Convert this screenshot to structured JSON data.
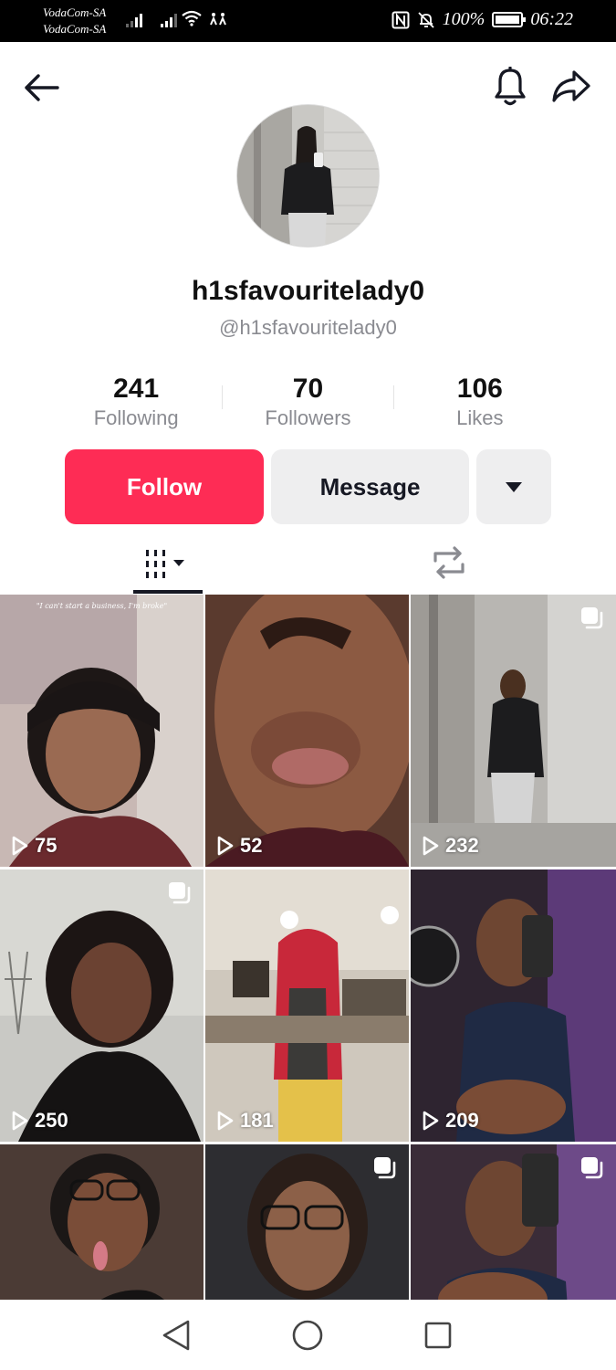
{
  "status_bar": {
    "carrier_1": "VodaCom-SA",
    "carrier_2": "VodaCom-SA",
    "battery": "100%",
    "time": "06:22"
  },
  "header": {
    "back_icon": "arrow-left-icon",
    "notification_icon": "bell-icon",
    "share_icon": "share-arrow-icon"
  },
  "profile": {
    "display_name": "h1sfavouritelady0",
    "handle": "@h1sfavouritelady0",
    "stats": [
      {
        "value": "241",
        "label": "Following"
      },
      {
        "value": "70",
        "label": "Followers"
      },
      {
        "value": "106",
        "label": "Likes"
      }
    ]
  },
  "actions": {
    "follow_label": "Follow",
    "message_label": "Message",
    "more_icon": "caret-down-icon"
  },
  "tabs": [
    {
      "icon": "videos-grid-icon",
      "active": true
    },
    {
      "icon": "repost-icon",
      "active": false
    }
  ],
  "colors": {
    "accent": "#fe2c55",
    "secondary_button": "#eeeeef",
    "muted_text": "#8a8b91"
  },
  "videos": [
    {
      "views": "75",
      "caption": "\"I can't start a business, I'm broke\"",
      "multi": false
    },
    {
      "views": "52",
      "caption": "",
      "multi": false
    },
    {
      "views": "232",
      "caption": "",
      "multi": true
    },
    {
      "views": "250",
      "caption": "",
      "multi": true
    },
    {
      "views": "181",
      "caption": "",
      "multi": false
    },
    {
      "views": "209",
      "caption": "",
      "multi": false
    },
    {
      "views": "",
      "caption": "",
      "multi": false
    },
    {
      "views": "",
      "caption": "",
      "multi": true
    },
    {
      "views": "",
      "caption": "",
      "multi": true
    }
  ],
  "nav_bar": [
    "back-triangle-icon",
    "home-circle-icon",
    "recents-square-icon"
  ]
}
